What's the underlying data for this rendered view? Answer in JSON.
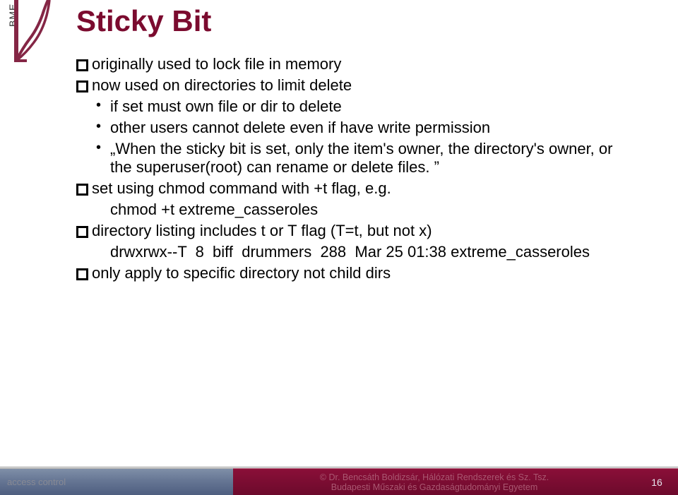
{
  "logo": {
    "text": "BME"
  },
  "title": "Sticky Bit",
  "bullets": {
    "b1": "originally used to lock file in memory",
    "b2": "now used on directories to limit delete",
    "b2a": "if set must own file or dir to delete",
    "b2b": "other users cannot delete even if have write permission",
    "b2c_quote": "„When the sticky bit is set, only the item's owner, the directory's owner, or the superuser(root) can rename or delete files. ”",
    "b3": "set using chmod command with +t flag, e.g.",
    "b3_code": "chmod +t extreme_casseroles",
    "b4": "directory listing includes t or T flag (T=t, but not x)",
    "b4_code": "drwxrwx--T  8  biff  drummers  288  Mar 25 01:38 extreme_casseroles",
    "b5": "only apply to specific directory not child dirs"
  },
  "footer": {
    "left": "access control",
    "mid_line1": "©   Dr. Bencsáth Boldizsár, Hálózati Rendszerek és Sz. Tsz.",
    "mid_line2": "Budapesti Műszaki és Gazdaságtudományi Egyetem",
    "page": "16"
  }
}
